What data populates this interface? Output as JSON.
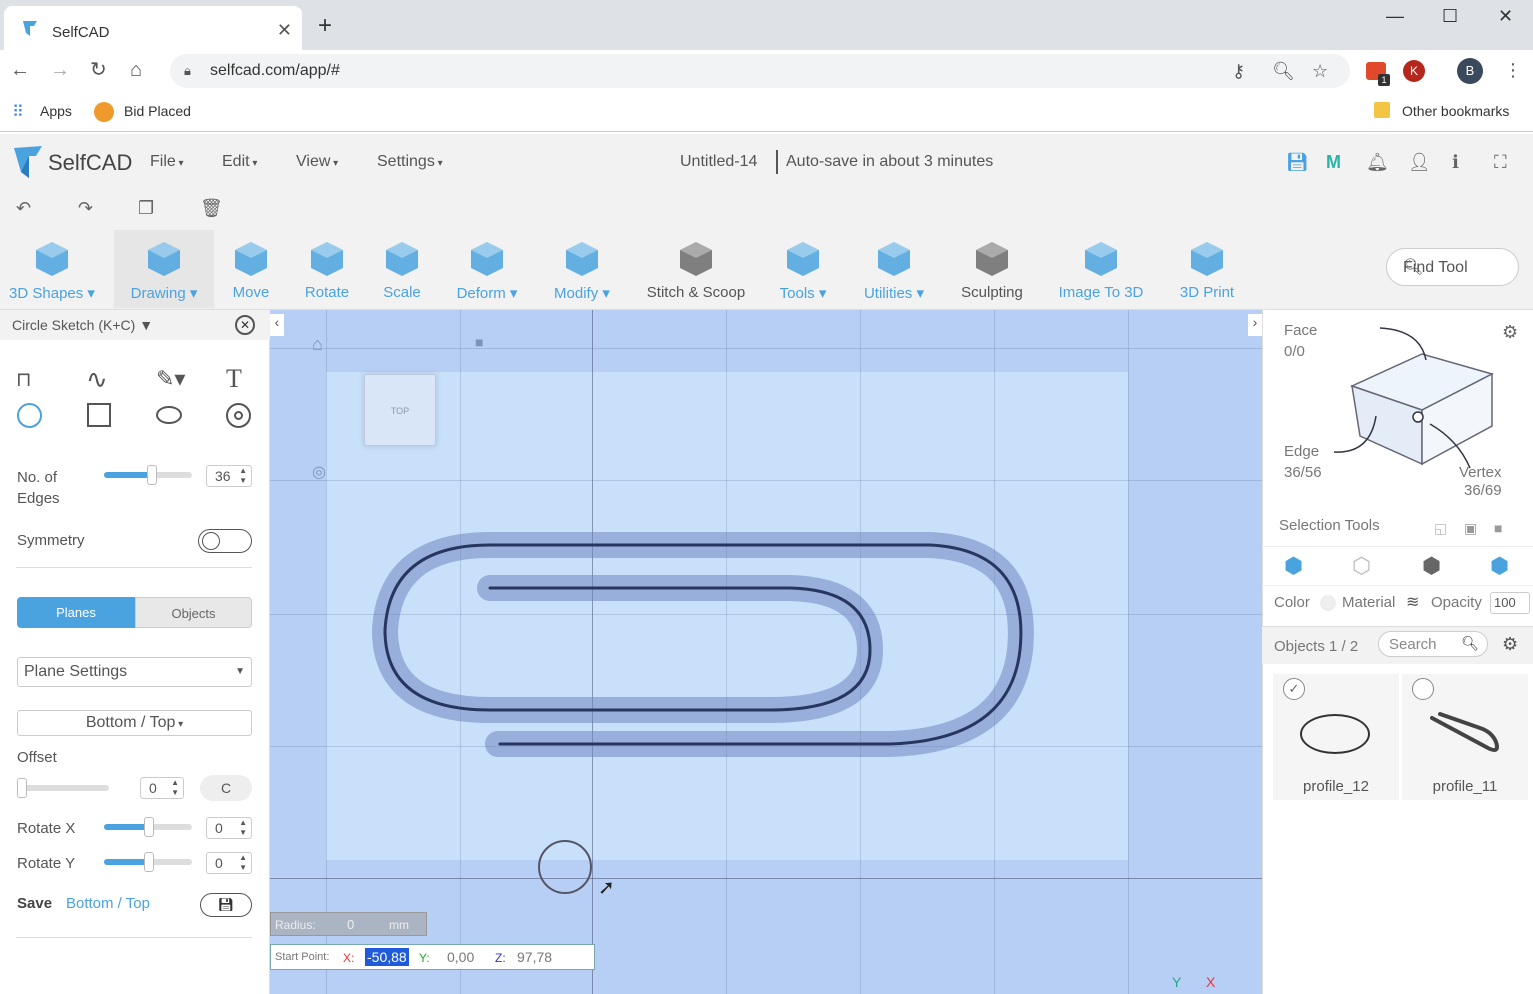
{
  "browser": {
    "tab_title": "SelfCAD",
    "url": "selfcad.com/app/#",
    "bookmarks": {
      "apps": "Apps",
      "bid_placed": "Bid Placed",
      "other": "Other bookmarks"
    },
    "profile_initial": "B",
    "ext_initial": "K",
    "ext_badge": "1"
  },
  "app": {
    "logo_text": "SelfCAD",
    "menus": [
      "File",
      "Edit",
      "View",
      "Settings"
    ],
    "doc_title": "Untitled-14",
    "autosave": "Auto-save in about 3 minutes"
  },
  "toolbar": {
    "tools": [
      {
        "label": "3D Shapes",
        "dropdown": true
      },
      {
        "label": "Drawing",
        "dropdown": true
      },
      {
        "label": "Move",
        "dropdown": false
      },
      {
        "label": "Rotate",
        "dropdown": false
      },
      {
        "label": "Scale",
        "dropdown": false
      },
      {
        "label": "Deform",
        "dropdown": true
      },
      {
        "label": "Modify",
        "dropdown": true
      },
      {
        "label": "Stitch & Scoop",
        "dropdown": false
      },
      {
        "label": "Tools",
        "dropdown": true
      },
      {
        "label": "Utilities",
        "dropdown": true
      },
      {
        "label": "Sculpting",
        "dropdown": false
      },
      {
        "label": "Image To 3D",
        "dropdown": false
      },
      {
        "label": "3D Print",
        "dropdown": false
      }
    ],
    "find_tool": "Find Tool"
  },
  "left_panel": {
    "title": "Circle Sketch (K+C)",
    "edges_label": "No. of Edges",
    "edges_value": "36",
    "edges_level": 0.55,
    "symmetry_label": "Symmetry",
    "symmetry_on": false,
    "tab_planes": "Planes",
    "tab_objects": "Objects",
    "plane_settings": "Plane Settings",
    "plane_view": "Bottom / Top",
    "offset_label": "Offset",
    "offset_value": "0",
    "rotate_x_label": "Rotate X",
    "rotate_x_value": "0",
    "rotate_y_label": "Rotate Y",
    "rotate_y_value": "0",
    "save_label": "Save",
    "save_target": "Bottom / Top"
  },
  "viewport": {
    "cube_label": "TOP",
    "radius_label": "Radius:",
    "radius_value": "0",
    "radius_unit": "mm",
    "start_point_label": "Start Point:",
    "x_label": "X:",
    "x_value": "-50,88",
    "y_label": "Y:",
    "y_value": "0,00",
    "z_label": "Z:",
    "z_value": "97,78",
    "axis_y": "Y",
    "axis_x": "X"
  },
  "right_panel": {
    "face_label": "Face",
    "face_value": "0/0",
    "edge_label": "Edge",
    "edge_value": "36/56",
    "vertex_label": "Vertex",
    "vertex_value": "36/69",
    "selection_tools": "Selection Tools",
    "color_label": "Color",
    "material_label": "Material",
    "opacity_label": "Opacity",
    "opacity_value": "100",
    "objects_label": "Objects 1 / 2",
    "search_placeholder": "Search",
    "objects": [
      {
        "name": "profile_12",
        "checked": true
      },
      {
        "name": "profile_11",
        "checked": false
      }
    ]
  },
  "colors": {
    "accent": "#4aa3df",
    "viewport": "#b7cff5"
  }
}
